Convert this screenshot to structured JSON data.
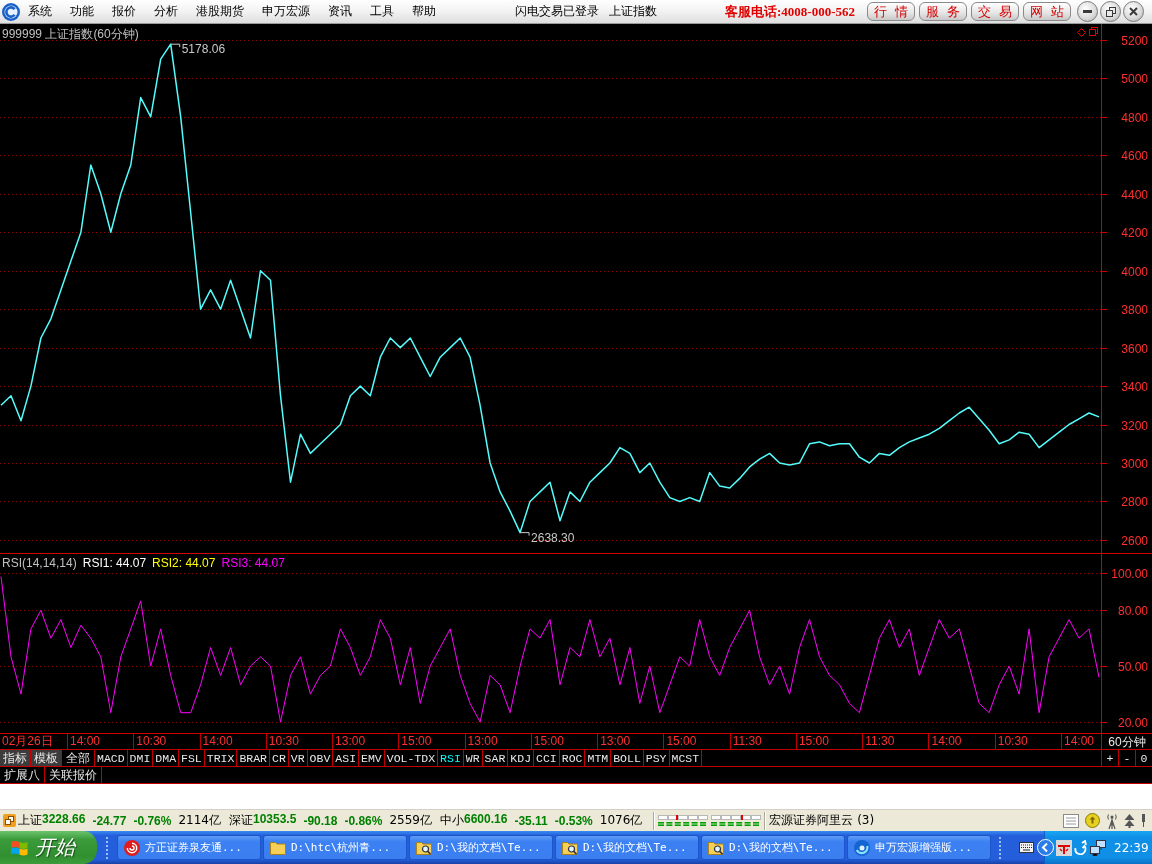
{
  "menu_bar": {
    "items": [
      "系统",
      "功能",
      "报价",
      "分析",
      "港股期货",
      "申万宏源",
      "资讯",
      "工具",
      "帮助"
    ],
    "status_texts": [
      "闪电交易已登录",
      "上证指数"
    ],
    "hotline": "客服电话:4008-000-562",
    "link_buttons": [
      "行 情",
      "服 务",
      "交 易",
      "网 站"
    ]
  },
  "price_panel": {
    "chart_data": {
      "type": "line",
      "title": "999999 上证指数(60分钟)",
      "series": [
        {
          "color": "#54fcfc",
          "values": [
            3300,
            3350,
            3220,
            3400,
            3650,
            3750,
            3900,
            4050,
            4200,
            4550,
            4400,
            4200,
            4400,
            4550,
            4900,
            4800,
            5100,
            5178,
            4800,
            4300,
            3800,
            3900,
            3800,
            3950,
            3800,
            3650,
            4000,
            3950,
            3350,
            2900,
            3150,
            3050,
            3100,
            3150,
            3200,
            3350,
            3400,
            3350,
            3550,
            3650,
            3600,
            3650,
            3550,
            3450,
            3550,
            3600,
            3650,
            3550,
            3300,
            3000,
            2850,
            2750,
            2638,
            2800,
            2850,
            2900,
            2700,
            2850,
            2800,
            2900,
            2950,
            3000,
            3080,
            3050,
            2950,
            3000,
            2900,
            2820,
            2800,
            2820,
            2800,
            2950,
            2880,
            2870,
            2920,
            2980,
            3020,
            3050,
            3000,
            2990,
            3000,
            3100,
            3110,
            3090,
            3100,
            3100,
            3030,
            3000,
            3050,
            3040,
            3080,
            3110,
            3130,
            3150,
            3180,
            3220,
            3260,
            3290,
            3230,
            3170,
            3100,
            3120,
            3160,
            3150,
            3080,
            3120,
            3160,
            3200,
            3230,
            3260,
            3240
          ]
        }
      ],
      "ylim": [
        2532,
        5283
      ],
      "yticks": [
        2600,
        2800,
        3000,
        3200,
        3400,
        3600,
        3800,
        4000,
        4200,
        4400,
        4600,
        4800,
        5000,
        5200
      ],
      "grid": true,
      "annotations": [
        "5178.06",
        "2638.30"
      ]
    }
  },
  "rsi_panel": {
    "chart_data": {
      "type": "line",
      "title": "RSI(14,14,14)",
      "series": [
        {
          "color": "#ff00ff",
          "values": [
            98,
            55,
            35,
            70,
            80,
            65,
            75,
            60,
            72,
            65,
            55,
            25,
            55,
            70,
            85,
            50,
            70,
            45,
            25,
            25,
            40,
            60,
            45,
            60,
            40,
            50,
            55,
            50,
            20,
            45,
            55,
            35,
            45,
            50,
            70,
            60,
            45,
            55,
            75,
            65,
            40,
            60,
            30,
            50,
            60,
            70,
            45,
            30,
            20,
            45,
            40,
            25,
            50,
            70,
            65,
            75,
            40,
            60,
            55,
            75,
            55,
            65,
            40,
            60,
            30,
            50,
            25,
            40,
            55,
            50,
            75,
            55,
            45,
            60,
            70,
            80,
            55,
            40,
            50,
            35,
            60,
            75,
            55,
            45,
            40,
            30,
            25,
            45,
            65,
            75,
            60,
            70,
            45,
            60,
            75,
            65,
            70,
            50,
            30,
            25,
            40,
            50,
            35,
            70,
            25,
            55,
            65,
            75,
            65,
            70,
            44
          ]
        }
      ],
      "ylim": [
        14.1,
        110.2
      ],
      "yticks": [
        {
          "value": 20,
          "label": "20.00"
        },
        {
          "value": 50,
          "label": "50.00"
        },
        {
          "value": 80,
          "label": "80.00"
        },
        {
          "value": 100,
          "label": "100.00"
        }
      ],
      "grid": true
    },
    "legend": [
      {
        "text": "RSI1: 44.07",
        "color": "#ffffff"
      },
      {
        "text": "RSI2: 44.07",
        "color": "#ffff00"
      },
      {
        "text": "RSI3: 44.07",
        "color": "#ff00ff"
      }
    ]
  },
  "time_axis": {
    "date": "02月26日",
    "labels": [
      "14:00",
      "10:30",
      "14:00",
      "10:30",
      "13:00",
      "15:00",
      "13:00",
      "15:00",
      "13:00",
      "15:00",
      "11:30",
      "15:00",
      "11:30",
      "14:00",
      "10:30",
      "14:00"
    ],
    "period": "60分钟"
  },
  "panel_buttons": [
    "指标",
    "模板"
  ],
  "indicator_tabs": [
    {
      "label": "全部",
      "selected": false
    },
    {
      "label": "MACD",
      "selected": false
    },
    {
      "label": "DMI",
      "selected": false
    },
    {
      "label": "DMA",
      "selected": false
    },
    {
      "label": "FSL",
      "selected": false
    },
    {
      "label": "TRIX",
      "selected": false
    },
    {
      "label": "BRAR",
      "selected": false
    },
    {
      "label": "CR",
      "selected": false
    },
    {
      "label": "VR",
      "selected": false
    },
    {
      "label": "OBV",
      "selected": false
    },
    {
      "label": "ASI",
      "selected": false
    },
    {
      "label": "EMV",
      "selected": false
    },
    {
      "label": "VOL-TDX",
      "selected": false
    },
    {
      "label": "RSI",
      "selected": true
    },
    {
      "label": "WR",
      "selected": false
    },
    {
      "label": "SAR",
      "selected": false
    },
    {
      "label": "KDJ",
      "selected": false
    },
    {
      "label": "CCI",
      "selected": false
    },
    {
      "label": "ROC",
      "selected": false
    },
    {
      "label": "MTM",
      "selected": false
    },
    {
      "label": "BOLL",
      "selected": false
    },
    {
      "label": "PSY",
      "selected": false
    },
    {
      "label": "MCST",
      "selected": false
    }
  ],
  "zoom_buttons": [
    "+",
    "-",
    "0"
  ],
  "extra_tabs": [
    "扩展八",
    "关联报价"
  ],
  "status_bar": {
    "indices": [
      {
        "name": "上证",
        "value": "3228.66",
        "change": "-24.77",
        "percent": "-0.76%",
        "turnover": "2114亿"
      },
      {
        "name": "深证",
        "value": "10353.5",
        "change": "-90.18",
        "percent": "-0.86%",
        "turnover": "2559亿"
      },
      {
        "name": "中小",
        "value": "6600.16",
        "change": "-35.11",
        "percent": "-0.53%",
        "turnover": "1076亿"
      }
    ],
    "connection": "宏源证券阿里云 (3)"
  },
  "taskbar": {
    "start": "开始",
    "tasks": [
      {
        "label": "方正证券泉友通...",
        "kind": "swirl"
      },
      {
        "label": "D:\\htc\\杭州青...",
        "kind": "folder"
      },
      {
        "label": "D:\\我的文档\\Te...",
        "kind": "search"
      },
      {
        "label": "D:\\我的文档\\Te...",
        "kind": "search"
      },
      {
        "label": "D:\\我的文档\\Te...",
        "kind": "search"
      },
      {
        "label": "申万宏源增强版...",
        "kind": "orb"
      }
    ],
    "clock": "22:39"
  }
}
